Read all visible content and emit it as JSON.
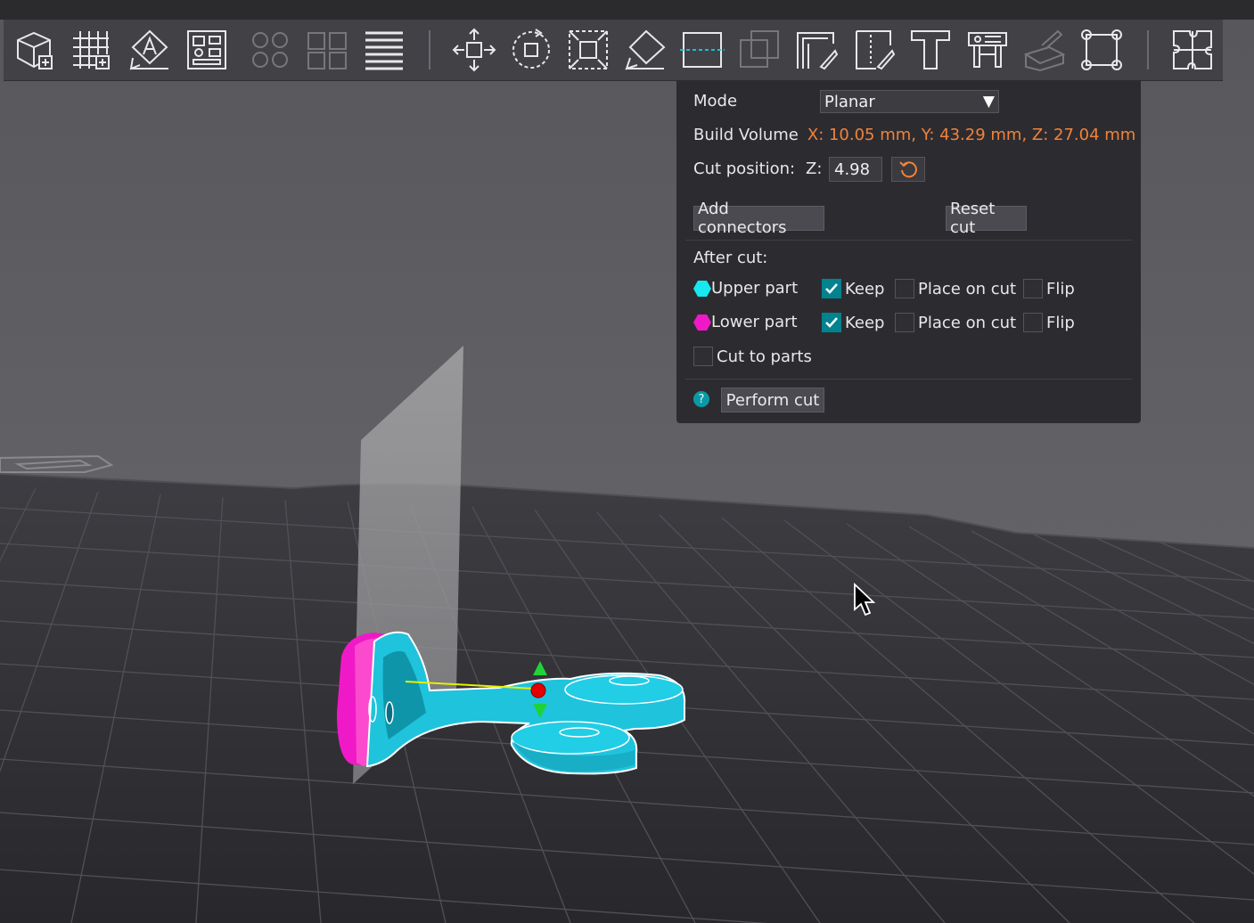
{
  "toolbar": {
    "buttons": [
      {
        "name": "add-object-icon",
        "disabled": false
      },
      {
        "name": "arrange-grid-icon",
        "disabled": false
      },
      {
        "name": "orient-icon",
        "disabled": false
      },
      {
        "name": "plate-layout-icon",
        "disabled": false
      },
      {
        "name": "split-objects-icon",
        "disabled": true
      },
      {
        "name": "split-parts-icon",
        "disabled": true
      },
      {
        "name": "layers-icon",
        "disabled": false
      },
      {
        "name": "move-icon",
        "disabled": false
      },
      {
        "name": "rotate-icon",
        "disabled": false
      },
      {
        "name": "scale-icon",
        "disabled": false
      },
      {
        "name": "lay-on-face-icon",
        "disabled": false
      },
      {
        "name": "cut-icon",
        "disabled": false
      },
      {
        "name": "mesh-boolean-icon",
        "disabled": true
      },
      {
        "name": "support-paint-icon",
        "disabled": false
      },
      {
        "name": "seam-paint-icon",
        "disabled": false
      },
      {
        "name": "text-icon",
        "disabled": false
      },
      {
        "name": "measure-icon",
        "disabled": false
      },
      {
        "name": "color-paint-icon",
        "disabled": true
      },
      {
        "name": "assembly-icon",
        "disabled": false
      },
      {
        "name": "puzzle-icon",
        "disabled": false
      }
    ]
  },
  "cut_panel": {
    "mode_label": "Mode",
    "mode_value": "Planar",
    "build_volume_label": "Build Volume",
    "build_volume_value": "X: 10.05 mm,  Y: 43.29 mm,  Z: 27.04 mm",
    "cut_position_label": "Cut position:",
    "z_label": "Z:",
    "z_value": "4.98",
    "add_connectors": "Add connectors",
    "reset_cut": "Reset cut",
    "after_cut_label": "After cut:",
    "upper_part": {
      "label": "Upper part",
      "color": "#17e8f0",
      "keep_label": "Keep",
      "keep": true,
      "place_label": "Place on cut",
      "place": false,
      "flip_label": "Flip",
      "flip": false
    },
    "lower_part": {
      "label": "Lower part",
      "color": "#f019c8",
      "keep_label": "Keep",
      "keep": true,
      "place_label": "Place on cut",
      "place": false,
      "flip_label": "Flip",
      "flip": false
    },
    "cut_to_parts_label": "Cut to parts",
    "cut_to_parts": false,
    "help_glyph": "?",
    "perform_cut": "Perform cut"
  },
  "colors": {
    "accent": "#00838f",
    "warning_text": "#f2823a",
    "model_upper": "#1fc3dc",
    "model_lower": "#f019c8"
  }
}
